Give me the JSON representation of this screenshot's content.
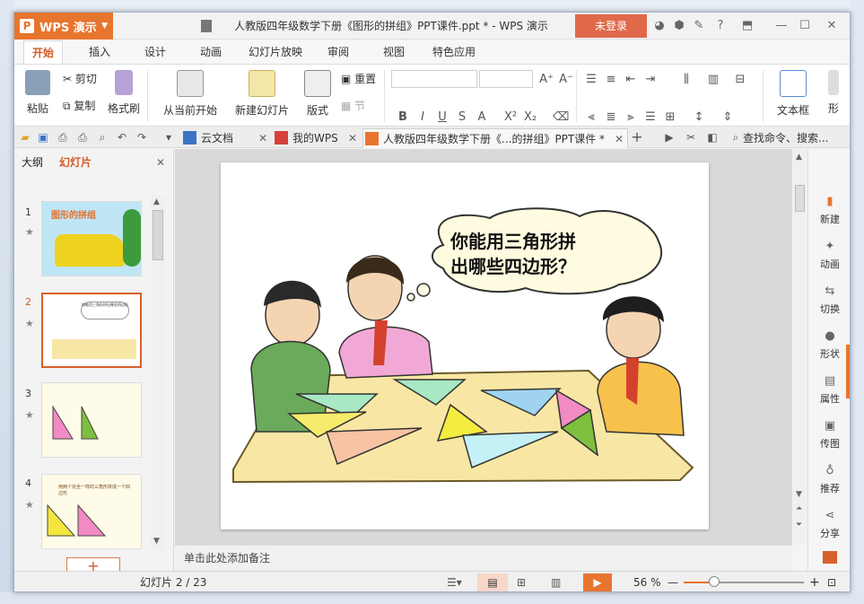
{
  "app": {
    "name": "WPS 演示",
    "logo": "P"
  },
  "window": {
    "title": "人教版四年级数学下册《图形的拼组》PPT课件.ppt * - WPS 演示",
    "login": "未登录"
  },
  "menu": {
    "tabs": [
      "开始",
      "插入",
      "设计",
      "动画",
      "幻灯片放映",
      "审阅",
      "视图",
      "特色应用"
    ]
  },
  "ribbon": {
    "paste": "粘贴",
    "cut": "剪切",
    "copy": "复制",
    "format_painter": "格式刷",
    "from_current": "从当前开始",
    "new_slide": "新建幻灯片",
    "layout": "版式",
    "reset": "重置",
    "section": "节",
    "textbox": "文本框",
    "shape_short": "形"
  },
  "doc_tabs": {
    "cloud": "云文档",
    "mywps": "我的WPS",
    "active": "人教版四年级数学下册《...的拼组》PPT课件 *",
    "search": "查找命令、搜索..."
  },
  "left_panel": {
    "tab_outline": "大纲",
    "tab_slides": "幻灯片",
    "slides": [
      {
        "num": "1",
        "text": "图形的拼组"
      },
      {
        "num": "2",
        "text": "你能用三角形拼出哪些四边形"
      },
      {
        "num": "3",
        "text": ""
      },
      {
        "num": "4",
        "text": "用两个完全一样的三角形拼成一个四边形"
      }
    ],
    "add_label": "+"
  },
  "slide": {
    "bubble_line1": "你能用三角形拼",
    "bubble_line2": "出哪些四边形？"
  },
  "notes": {
    "placeholder": "单击此处添加备注"
  },
  "right_bar": {
    "items": [
      "新建",
      "动画",
      "切换",
      "形状",
      "属性",
      "传图",
      "推荐",
      "分享"
    ]
  },
  "status": {
    "slide_info": "幻灯片 2 / 23",
    "zoom": "56 %"
  },
  "colors": {
    "accent": "#e8752e",
    "login": "#e0694a",
    "play": "#e8752e"
  }
}
